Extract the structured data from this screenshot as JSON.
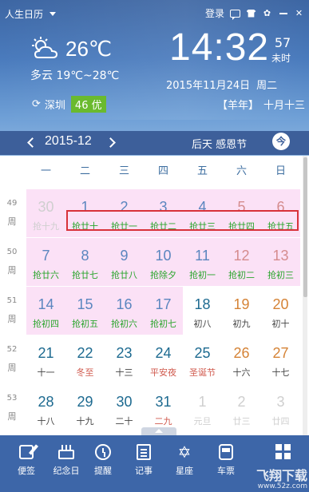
{
  "app": {
    "name": "人生日历"
  },
  "topbar": {
    "login": "登录"
  },
  "weather": {
    "temp": "26℃",
    "desc": "多云 19℃~28℃",
    "city": "深圳",
    "aqi": "46 优"
  },
  "clock": {
    "time": "14:32",
    "seconds": "57",
    "seconds_label": "未时"
  },
  "date": {
    "full": "2015年11月24日",
    "weekday": "周二",
    "lunar_year": "【羊年】",
    "lunar_date": "十月十三"
  },
  "nav": {
    "month": "2015-12",
    "festival": "后天 感恩节",
    "today_btn": "今"
  },
  "weekdays": [
    "一",
    "二",
    "三",
    "四",
    "五",
    "六",
    "日"
  ],
  "weeks": [
    {
      "num": "49",
      "label": "周",
      "days": [
        {
          "d": "30",
          "l": "抢十九",
          "c": "c-grey",
          "lc": "c-grey",
          "bg": true
        },
        {
          "d": "1",
          "l": "抢廿十",
          "c": "c-blue",
          "lc": "c-green",
          "bg": true
        },
        {
          "d": "2",
          "l": "抢廿一",
          "c": "c-blue",
          "lc": "c-green",
          "bg": true
        },
        {
          "d": "3",
          "l": "抢廿二",
          "c": "c-blue",
          "lc": "c-green",
          "bg": true
        },
        {
          "d": "4",
          "l": "抢廿三",
          "c": "c-blue",
          "lc": "c-green",
          "bg": true
        },
        {
          "d": "5",
          "l": "抢廿四",
          "c": "c-pinkd",
          "lc": "c-green",
          "bg": true
        },
        {
          "d": "6",
          "l": "抢廿五",
          "c": "c-pinkd",
          "lc": "c-green",
          "bg": true
        }
      ]
    },
    {
      "num": "50",
      "label": "周",
      "days": [
        {
          "d": "7",
          "l": "抢廿六",
          "c": "c-blue",
          "lc": "c-green",
          "bg": true
        },
        {
          "d": "8",
          "l": "抢廿七",
          "c": "c-blue",
          "lc": "c-green",
          "bg": true
        },
        {
          "d": "9",
          "l": "抢廿八",
          "c": "c-blue",
          "lc": "c-green",
          "bg": true
        },
        {
          "d": "10",
          "l": "抢除夕",
          "c": "c-blue",
          "lc": "c-green",
          "bg": true
        },
        {
          "d": "11",
          "l": "抢初一",
          "c": "c-blue",
          "lc": "c-green",
          "bg": true
        },
        {
          "d": "12",
          "l": "抢初二",
          "c": "c-pinkd",
          "lc": "c-green",
          "bg": true
        },
        {
          "d": "13",
          "l": "抢初三",
          "c": "c-pinkd",
          "lc": "c-green",
          "bg": true
        }
      ]
    },
    {
      "num": "51",
      "label": "周",
      "days": [
        {
          "d": "14",
          "l": "抢初四",
          "c": "c-blue",
          "lc": "c-green",
          "bg": true
        },
        {
          "d": "15",
          "l": "抢初五",
          "c": "c-blue",
          "lc": "c-green",
          "bg": true
        },
        {
          "d": "16",
          "l": "抢初六",
          "c": "c-blue",
          "lc": "c-green",
          "bg": true
        },
        {
          "d": "17",
          "l": "抢初七",
          "c": "c-blue",
          "lc": "c-green",
          "bg": true
        },
        {
          "d": "18",
          "l": "初八",
          "c": "c-dark",
          "lc": "c-black",
          "bg": false
        },
        {
          "d": "19",
          "l": "初九",
          "c": "c-orange",
          "lc": "c-black",
          "bg": false
        },
        {
          "d": "20",
          "l": "初十",
          "c": "c-orange",
          "lc": "c-black",
          "bg": false
        }
      ]
    },
    {
      "num": "52",
      "label": "周",
      "days": [
        {
          "d": "21",
          "l": "十一",
          "c": "c-dark",
          "lc": "c-black",
          "bg": false
        },
        {
          "d": "22",
          "l": "冬至",
          "c": "c-dark",
          "lc": "c-red",
          "bg": false
        },
        {
          "d": "23",
          "l": "十三",
          "c": "c-dark",
          "lc": "c-black",
          "bg": false
        },
        {
          "d": "24",
          "l": "平安夜",
          "c": "c-dark",
          "lc": "c-red",
          "bg": false
        },
        {
          "d": "25",
          "l": "圣诞节",
          "c": "c-dark",
          "lc": "c-red",
          "bg": false
        },
        {
          "d": "26",
          "l": "十六",
          "c": "c-orange",
          "lc": "c-black",
          "bg": false
        },
        {
          "d": "27",
          "l": "十七",
          "c": "c-orange",
          "lc": "c-black",
          "bg": false
        }
      ]
    },
    {
      "num": "53",
      "label": "周",
      "days": [
        {
          "d": "28",
          "l": "十八",
          "c": "c-dark",
          "lc": "c-black",
          "bg": false
        },
        {
          "d": "29",
          "l": "十九",
          "c": "c-dark",
          "lc": "c-black",
          "bg": false
        },
        {
          "d": "30",
          "l": "二十",
          "c": "c-dark",
          "lc": "c-black",
          "bg": false
        },
        {
          "d": "31",
          "l": "二九",
          "c": "c-dark",
          "lc": "c-red",
          "bg": false
        },
        {
          "d": "1",
          "l": "元旦",
          "c": "c-grey",
          "lc": "c-grey",
          "bg": false
        },
        {
          "d": "2",
          "l": "廿三",
          "c": "c-grey",
          "lc": "c-grey",
          "bg": false
        },
        {
          "d": "3",
          "l": "廿四",
          "c": "c-grey",
          "lc": "c-grey",
          "bg": false
        }
      ]
    }
  ],
  "toolbar": {
    "items": [
      {
        "label": "便签",
        "icon": "pencil-icon"
      },
      {
        "label": "纪念日",
        "icon": "cake-icon"
      },
      {
        "label": "提醒",
        "icon": "alarm-clock-icon"
      },
      {
        "label": "记事",
        "icon": "notebook-icon"
      },
      {
        "label": "星座",
        "icon": "star-icon"
      },
      {
        "label": "车票",
        "icon": "bus-icon"
      },
      {
        "label": "",
        "icon": "apps-grid-icon"
      }
    ]
  },
  "watermark": {
    "text": "飞翔下载",
    "sub": "www.52z.com"
  }
}
